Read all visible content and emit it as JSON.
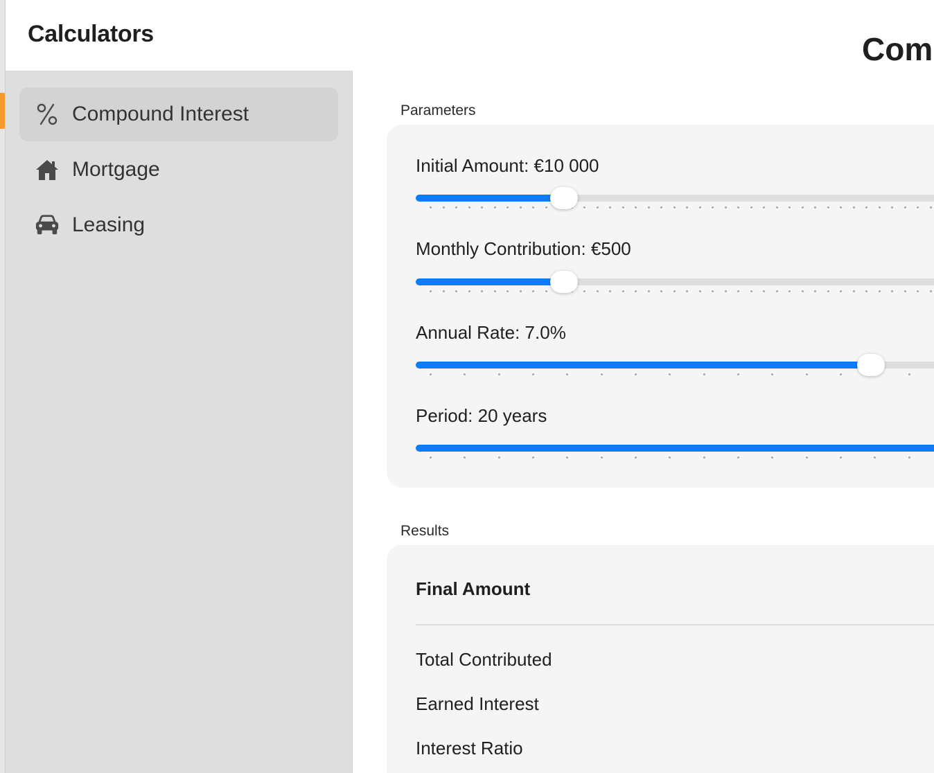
{
  "sidebar": {
    "title": "Calculators",
    "items": [
      {
        "label": "Compound Interest",
        "icon": "percent-icon",
        "active": true
      },
      {
        "label": "Mortgage",
        "icon": "house-icon",
        "active": false
      },
      {
        "label": "Leasing",
        "icon": "car-icon",
        "active": false
      }
    ]
  },
  "main": {
    "title": "Comp",
    "parameters": {
      "section_label": "Parameters",
      "initial_amount": {
        "label": "Initial Amount: €10 000",
        "level": 0.27,
        "ticks": 41
      },
      "monthly_contribution": {
        "label": "Monthly Contribution: €500",
        "level": 0.27,
        "ticks": 41
      },
      "annual_rate": {
        "label": "Annual Rate: 7.0%",
        "level": 0.885,
        "ticks": 16
      },
      "period": {
        "label": "Period: 20 years",
        "level": 1.0,
        "ticks": 16
      }
    },
    "results": {
      "section_label": "Results",
      "final_amount_label": "Final Amount",
      "total_contributed_label": "Total Contributed",
      "earned_interest_label": "Earned Interest",
      "interest_ratio_label": "Interest Ratio"
    }
  },
  "colors": {
    "accent": "#0a7cff",
    "window_accent": "#f39a2a",
    "sidebar_bg": "#dedede",
    "card_bg": "#f5f5f5"
  }
}
